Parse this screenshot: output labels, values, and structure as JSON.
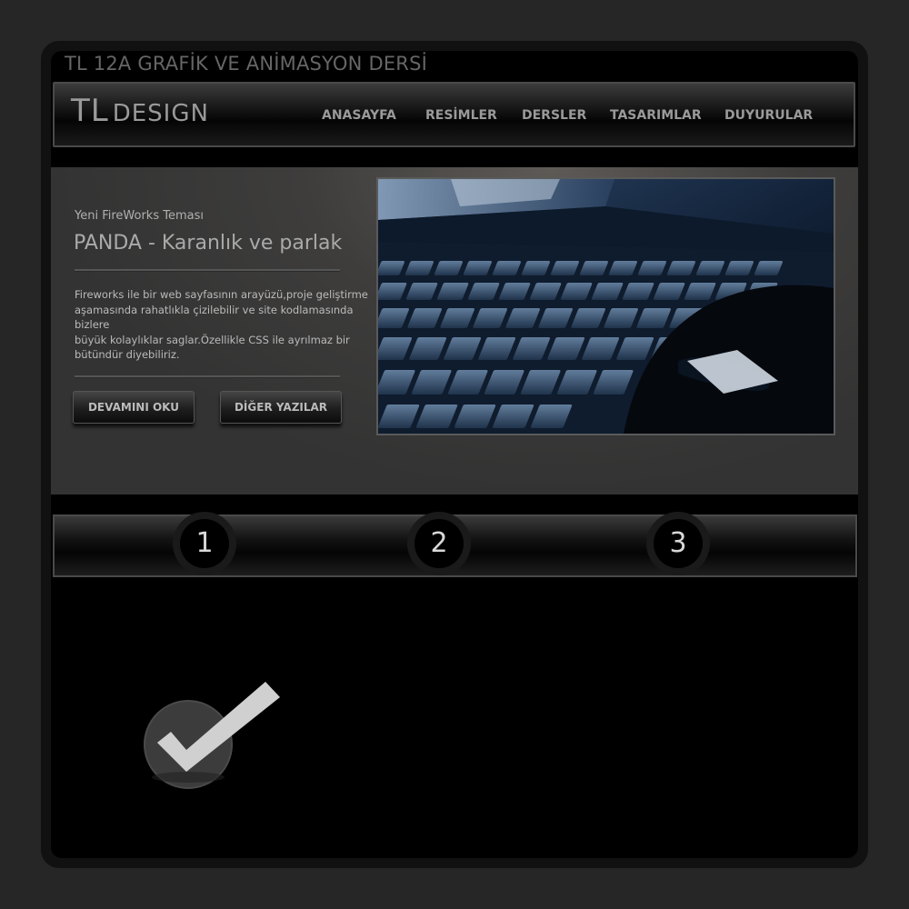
{
  "site": {
    "title": "TL 12A GRAFİK VE ANİMASYON DERSİ"
  },
  "header": {
    "logo_primary": "TL",
    "logo_secondary": "DESIGN",
    "nav": [
      "ANASAYFA",
      "RESİMLER",
      "DERSLER",
      "TASARIMLAR",
      "DUYURULAR"
    ]
  },
  "hero": {
    "subtitle": "Yeni FireWorks Teması",
    "title": "PANDA - Karanlık ve parlak",
    "body_lines": [
      "Fireworks ile bir web sayfasının arayüzü,proje geliştirme",
      "aşamasında rahatlıkla çizilebilir ve site kodlamasında",
      "bizlere",
      "büyük kolaylıklar saglar.Özellikle CSS ile ayrılmaz bir",
      "bütündür diyebiliriz."
    ],
    "read_more": "DEVAMINI OKU",
    "other_posts": "DİĞER YAZILAR"
  },
  "pager": [
    "1",
    "2",
    "3"
  ],
  "colors": {
    "background": "#262626",
    "frame": "#111111",
    "panel": "#000000",
    "hero_bg": "#333333",
    "text": "#9a9a9a"
  },
  "icons": [
    "check-icon",
    "laptop-keyboard-image"
  ]
}
